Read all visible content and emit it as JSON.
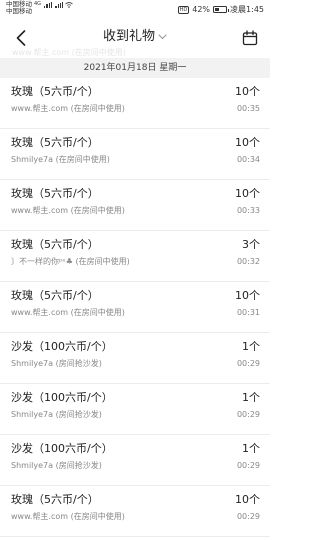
{
  "status_bar": {
    "carrier1": "中国移动",
    "network": "4G",
    "carrier2": "中国移动",
    "hd": "HD",
    "battery_text": "42%",
    "battery_level": 0.42,
    "time": "凌晨1:45"
  },
  "header": {
    "title": "收到礼物",
    "faded_text": "www.帮主.com (在房间中使用)"
  },
  "date_bar": {
    "date": "2021年01月18日 星期一"
  },
  "gifts": [
    {
      "name": "玫瑰（5六币/个）",
      "sender": "www.帮主.com (在房间中使用)",
      "count": "10个",
      "time": "00:35"
    },
    {
      "name": "玫瑰（5六币/个）",
      "sender": "Shmilye7a (在房间中使用)",
      "count": "10个",
      "time": "00:34"
    },
    {
      "name": "玫瑰（5六币/个）",
      "sender": "www.帮主.com (在房间中使用)",
      "count": "10个",
      "time": "00:33"
    },
    {
      "name": "玫瑰（5六币/个）",
      "sender": "〕不一样的你ᵖᵉ♣ (在房间中使用)",
      "count": "3个",
      "time": "00:32"
    },
    {
      "name": "玫瑰（5六币/个）",
      "sender": "www.帮主.com (在房间中使用)",
      "count": "10个",
      "time": "00:31"
    },
    {
      "name": "沙发（100六币/个）",
      "sender": "Shmilye7a (房间抢沙发)",
      "count": "1个",
      "time": "00:29"
    },
    {
      "name": "沙发（100六币/个）",
      "sender": "Shmilye7a (房间抢沙发)",
      "count": "1个",
      "time": "00:29"
    },
    {
      "name": "沙发（100六币/个）",
      "sender": "Shmilye7a (房间抢沙发)",
      "count": "1个",
      "time": "00:29"
    },
    {
      "name": "玫瑰（5六币/个）",
      "sender": "www.帮主.com (在房间中使用)",
      "count": "10个",
      "time": "00:29"
    }
  ]
}
